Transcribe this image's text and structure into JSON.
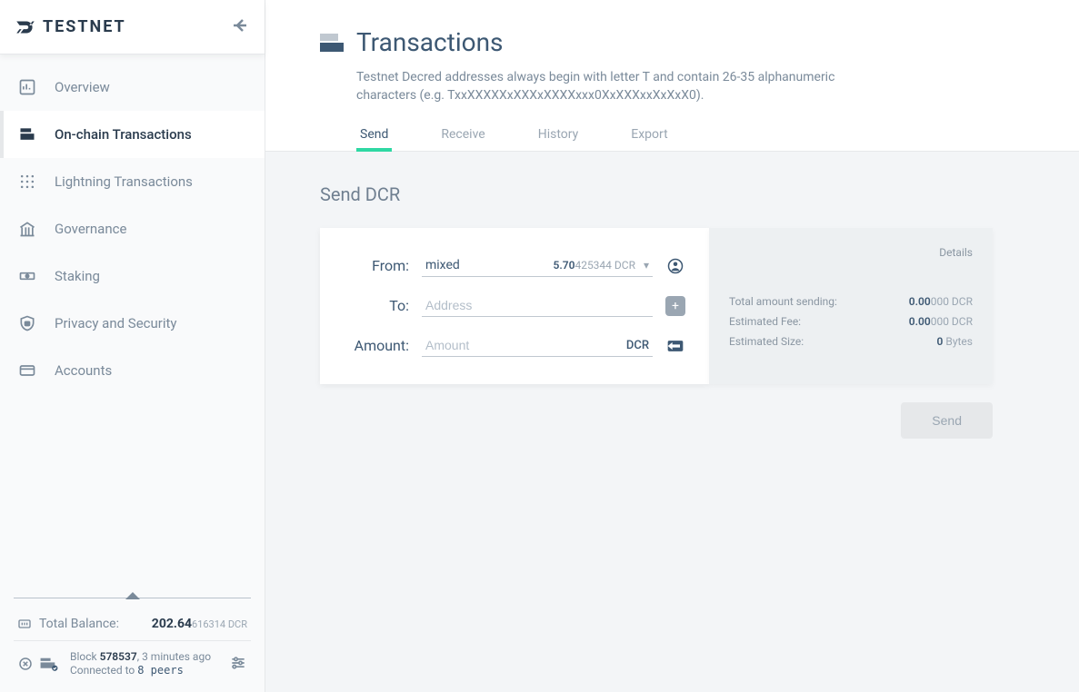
{
  "brand": {
    "name": "TESTNET"
  },
  "sidebar": {
    "items": [
      {
        "label": "Overview"
      },
      {
        "label": "On-chain Transactions"
      },
      {
        "label": "Lightning Transactions"
      },
      {
        "label": "Governance"
      },
      {
        "label": "Staking"
      },
      {
        "label": "Privacy and Security"
      },
      {
        "label": "Accounts"
      }
    ],
    "balance": {
      "label": "Total Balance:",
      "major": "202.64",
      "minor": "616314",
      "unit": " DCR"
    },
    "status": {
      "block_label": "Block",
      "block_number": "578537",
      "block_age": ", 3 minutes ago",
      "connected_label": "Connected to ",
      "peers": "8 peers"
    }
  },
  "page": {
    "title": "Transactions",
    "description": "Testnet Decred addresses always begin with letter T and contain 26-35 alphanumeric characters (e.g. TxxXXXXXxXXXxXXXXxxx0XxXXXxxXxXxX0).",
    "tabs": [
      {
        "label": "Send"
      },
      {
        "label": "Receive"
      },
      {
        "label": "History"
      },
      {
        "label": "Export"
      }
    ]
  },
  "send": {
    "section_title": "Send DCR",
    "from_label": "From:",
    "from_account": "mixed",
    "from_balance_major": "5.70",
    "from_balance_minor": "425344 DCR",
    "to_label": "To:",
    "to_placeholder": "Address",
    "amount_label": "Amount:",
    "amount_placeholder": "Amount",
    "amount_currency": "DCR",
    "add_recipient_label": "+",
    "details": {
      "title": "Details",
      "total_label": "Total amount sending:",
      "total_major": "0.00",
      "total_minor": "000 DCR",
      "fee_label": "Estimated Fee:",
      "fee_major": "0.00",
      "fee_minor": "000 DCR",
      "size_label": "Estimated Size:",
      "size_value": "0",
      "size_unit": " Bytes"
    },
    "send_button": "Send"
  }
}
